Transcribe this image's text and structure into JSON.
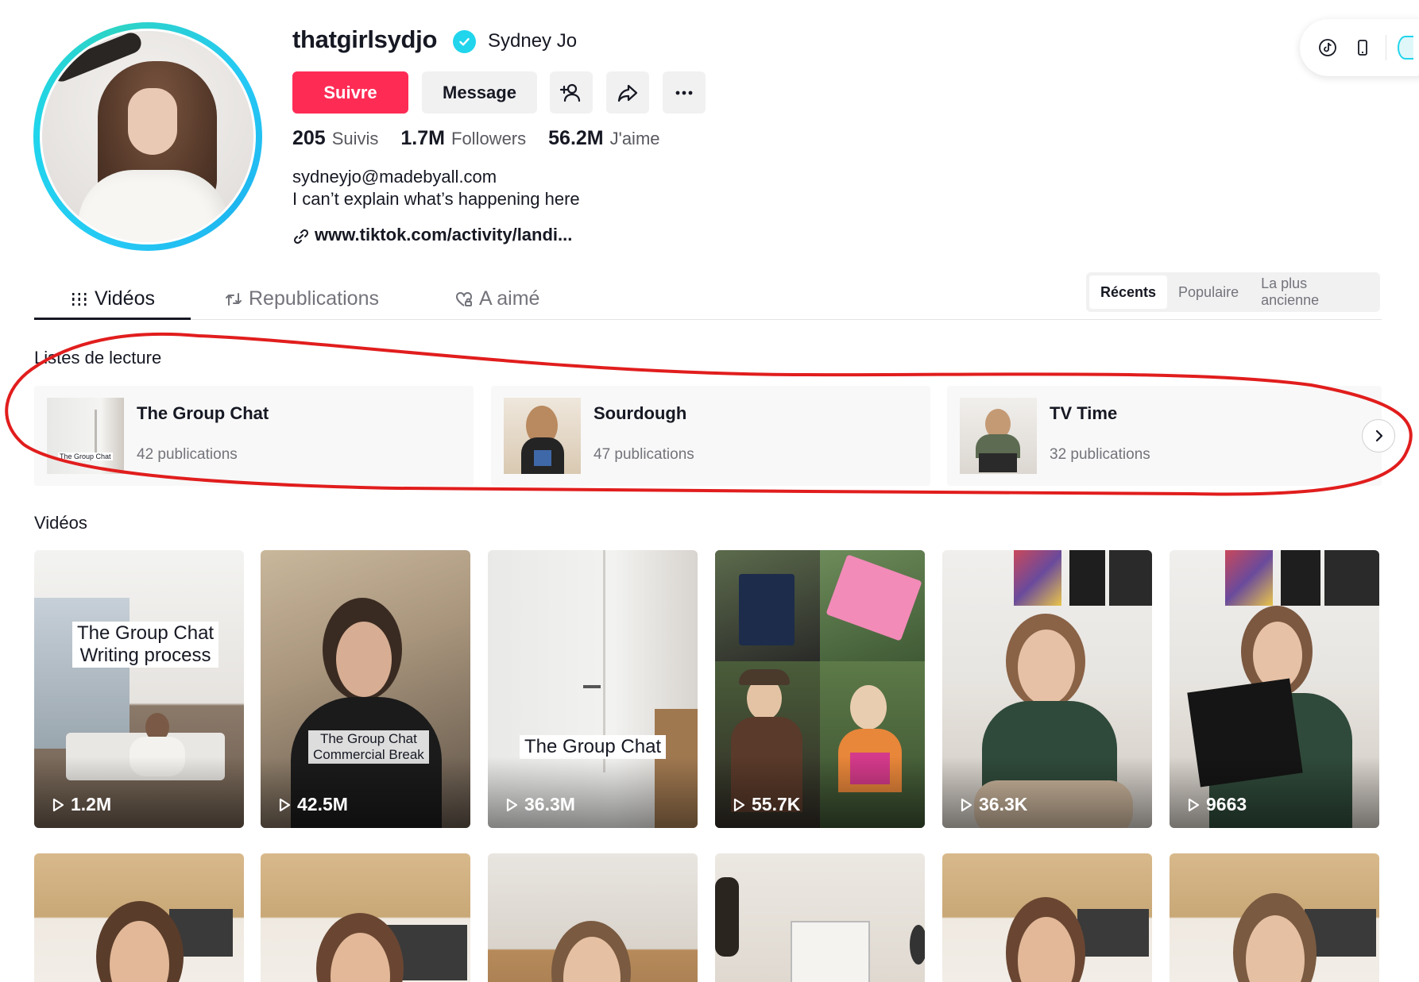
{
  "profile": {
    "username": "thatgirlsydjo",
    "nickname": "Sydney Jo",
    "follow_label": "Suivre",
    "message_label": "Message",
    "stats": [
      {
        "value": "205",
        "label": "Suivis"
      },
      {
        "value": "1.7M",
        "label": "Followers"
      },
      {
        "value": "56.2M",
        "label": "J'aime"
      }
    ],
    "bio_line1": "sydneyjo@madebyall.com",
    "bio_line2": "I can’t explain what’s happening here",
    "link": "www.tiktok.com/activity/landi..."
  },
  "tabs": [
    {
      "label": "Vidéos",
      "icon": "grid-icon",
      "active": true
    },
    {
      "label": "Republications",
      "icon": "repost-icon"
    },
    {
      "label": "A aimé",
      "icon": "heart-lock-icon"
    }
  ],
  "sort": {
    "options": [
      "Récents",
      "Populaire",
      "La plus ancienne"
    ],
    "selected": "Récents"
  },
  "playlists": {
    "title": "Listes de lecture",
    "items": [
      {
        "name": "The Group Chat",
        "count": "42 publications",
        "thumb_caption": "The Group Chat"
      },
      {
        "name": "Sourdough",
        "count": "47 publications"
      },
      {
        "name": "TV Time",
        "count": "32 publications"
      }
    ]
  },
  "videos": {
    "title": "Vidéos",
    "items": [
      {
        "views": "1.2M",
        "caption_line1": "The Group Chat",
        "caption_line2": "Writing process"
      },
      {
        "views": "42.5M",
        "caption_line1": "The Group Chat",
        "caption_line2": "Commercial Break"
      },
      {
        "views": "36.3M",
        "caption_line1": "The Group Chat"
      },
      {
        "views": "55.7K"
      },
      {
        "views": "36.3K"
      },
      {
        "views": "9663"
      }
    ]
  },
  "colors": {
    "follow": "#fe2c55",
    "verified": "#20d5ec",
    "annotation": "#e11d1d"
  }
}
